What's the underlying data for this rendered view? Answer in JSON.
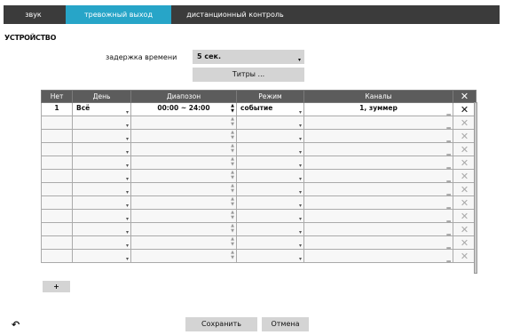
{
  "tabs": [
    {
      "label": "звук",
      "active": false
    },
    {
      "label": "тревожный выход",
      "active": true
    },
    {
      "label": "дистанционный контроль",
      "active": false
    }
  ],
  "section_title": "УСТРОЙСТВО",
  "delay": {
    "label": "задержка времени",
    "value": "5 сек."
  },
  "titles_button": "Титры ...",
  "table": {
    "headers": [
      "Нет",
      "День",
      "Диапозон",
      "Режим",
      "Каналы"
    ],
    "rows": [
      {
        "no": "1",
        "day": "Всё",
        "range": "00:00 ~ 24:00",
        "mode": "событие",
        "channels": "1, зуммер"
      },
      {
        "no": "",
        "day": "",
        "range": "",
        "mode": "",
        "channels": ""
      },
      {
        "no": "",
        "day": "",
        "range": "",
        "mode": "",
        "channels": ""
      },
      {
        "no": "",
        "day": "",
        "range": "",
        "mode": "",
        "channels": ""
      },
      {
        "no": "",
        "day": "",
        "range": "",
        "mode": "",
        "channels": ""
      },
      {
        "no": "",
        "day": "",
        "range": "",
        "mode": "",
        "channels": ""
      },
      {
        "no": "",
        "day": "",
        "range": "",
        "mode": "",
        "channels": ""
      },
      {
        "no": "",
        "day": "",
        "range": "",
        "mode": "",
        "channels": ""
      },
      {
        "no": "",
        "day": "",
        "range": "",
        "mode": "",
        "channels": ""
      },
      {
        "no": "",
        "day": "",
        "range": "",
        "mode": "",
        "channels": ""
      },
      {
        "no": "",
        "day": "",
        "range": "",
        "mode": "",
        "channels": ""
      },
      {
        "no": "",
        "day": "",
        "range": "",
        "mode": "",
        "channels": ""
      }
    ]
  },
  "add_button": "+",
  "save_button": "Сохранить",
  "cancel_button": "Отмена"
}
